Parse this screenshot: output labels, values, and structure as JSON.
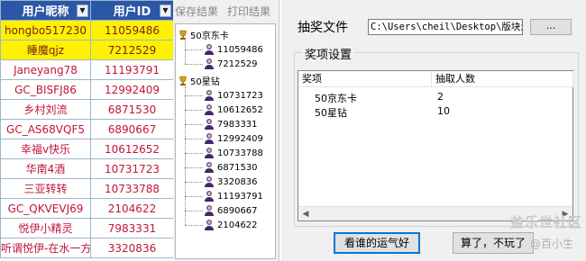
{
  "sheet": {
    "headers": [
      "用户昵称",
      "用户ID"
    ],
    "filter_glyph": "▼",
    "rows": [
      {
        "name": "hongbo517230",
        "id": "11059486",
        "highlight": true
      },
      {
        "name": "睡魔qjz",
        "id": "7212529",
        "highlight": true
      },
      {
        "name": "Janeyang78",
        "id": "11193791",
        "highlight": false
      },
      {
        "name": "GC_BISFJ86",
        "id": "12992409",
        "highlight": false
      },
      {
        "name": "乡村刘流",
        "id": "6871530",
        "highlight": false
      },
      {
        "name": "GC_AS68VQF5",
        "id": "6890667",
        "highlight": false
      },
      {
        "name": "幸福v快乐",
        "id": "10612652",
        "highlight": false
      },
      {
        "name": "华南4酒",
        "id": "10731723",
        "highlight": false
      },
      {
        "name": "三亚转转",
        "id": "10733788",
        "highlight": false
      },
      {
        "name": "GC_QKVEVJ69",
        "id": "2104622",
        "highlight": false
      },
      {
        "name": "悦伊小精灵",
        "id": "7983331",
        "highlight": false
      },
      {
        "name": "听谓悦伊-在水一方",
        "id": "3320836",
        "highlight": false
      }
    ]
  },
  "tree": {
    "toolbar": {
      "save": "保存结果",
      "print": "打印结果"
    },
    "groups": [
      {
        "label": "50京东卡",
        "items": [
          "11059486",
          "7212529"
        ]
      },
      {
        "label": "50星钻",
        "items": [
          "10731723",
          "10612652",
          "7983331",
          "12992409",
          "10733788",
          "6871530",
          "3320836",
          "11193791",
          "6890667",
          "2104622"
        ]
      }
    ]
  },
  "dialog": {
    "file_label": "抽奖文件",
    "file_path": "C:\\Users\\cheil\\Desktop\\版块活",
    "browse_label": "...",
    "group_title": "奖项设置",
    "columns": [
      "奖项",
      "抽取人数"
    ],
    "prizes": [
      {
        "name": "50京东卡",
        "count": "2"
      },
      {
        "name": "50星钻",
        "count": "10"
      }
    ],
    "buttons": {
      "draw": "看谁的运气好",
      "quit": "算了，不玩了"
    },
    "scroll_left": "◀",
    "scroll_right": "▶"
  },
  "watermark": {
    "site": "益乐世社区",
    "user": "@百小生"
  },
  "colors": {
    "header_bg": "#2b57a7",
    "highlight": "#fdf100",
    "name_text": "#c0153b",
    "dialog_bg": "#f0f0f0"
  }
}
